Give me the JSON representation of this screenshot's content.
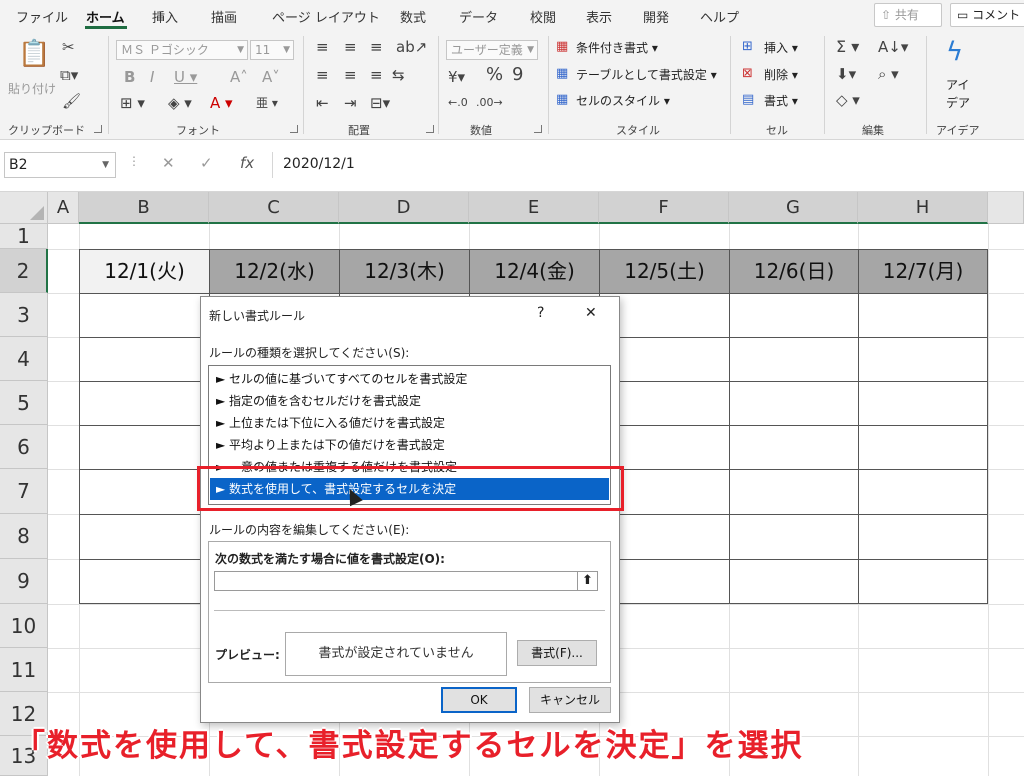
{
  "menu": {
    "tabs": [
      "ファイル",
      "ホーム",
      "挿入",
      "描画",
      "ページ レイアウト",
      "数式",
      "データ",
      "校閲",
      "表示",
      "開発",
      "ヘルプ"
    ],
    "share_label": "共有",
    "comment_label": "コメント"
  },
  "ribbon": {
    "clipboard": {
      "paste_label": "貼り付け",
      "group_label": "クリップボード"
    },
    "font": {
      "font_name": "ＭＳ Ｐゴシック",
      "font_size": "11",
      "group_label": "フォント"
    },
    "alignment": {
      "group_label": "配置"
    },
    "number": {
      "format": "ユーザー定義",
      "group_label": "数値"
    },
    "styles": {
      "conditional_format": "条件付き書式",
      "format_as_table": "テーブルとして書式設定",
      "cell_styles": "セルのスタイル",
      "group_label": "スタイル"
    },
    "cells": {
      "insert": "挿入",
      "delete": "削除",
      "format": "書式",
      "group_label": "セル"
    },
    "editing": {
      "group_label": "編集"
    },
    "ideas": {
      "label_line1": "アイ",
      "label_line2": "デア",
      "group_label": "アイデア"
    }
  },
  "formula_bar": {
    "name_box": "B2",
    "formula": "2020/12/1",
    "fx_label": "fx"
  },
  "grid": {
    "columns": [
      "A",
      "B",
      "C",
      "D",
      "E",
      "F",
      "G",
      "H"
    ],
    "rows": [
      "1",
      "2",
      "3",
      "4",
      "5",
      "6",
      "7",
      "8",
      "9",
      "10",
      "11",
      "12",
      "13"
    ],
    "row2_dates": [
      "12/1(火)",
      "12/2(水)",
      "12/3(木)",
      "12/4(金)",
      "12/5(土)",
      "12/6(日)",
      "12/7(月)"
    ]
  },
  "dialog": {
    "title": "新しい書式ルール",
    "help": "?",
    "close": "✕",
    "rule_type_label": "ルールの種類を選択してください(S):",
    "rule_types": [
      "► セルの値に基づいてすべてのセルを書式設定",
      "► 指定の値を含むセルだけを書式設定",
      "► 上位または下位に入る値だけを書式設定",
      "► 平均より上または下の値だけを書式設定",
      "► 一意の値または重複する値だけを書式設定",
      "► 数式を使用して、書式設定するセルを決定"
    ],
    "selected_index": 5,
    "edit_label": "ルールの内容を編集してください(E):",
    "formula_label": "次の数式を満たす場合に値を書式設定(O):",
    "formula_value": "",
    "preview_label": "プレビュー:",
    "preview_text": "書式が設定されていません",
    "format_button": "書式(F)...",
    "ok_button": "OK",
    "cancel_button": "キャンセル"
  },
  "caption": "「数式を使用して、書式設定するセルを決定」を選択",
  "colors": {
    "accent_green": "#217346",
    "selection_blue": "#0a64c8",
    "highlight_red": "#e8202a"
  }
}
